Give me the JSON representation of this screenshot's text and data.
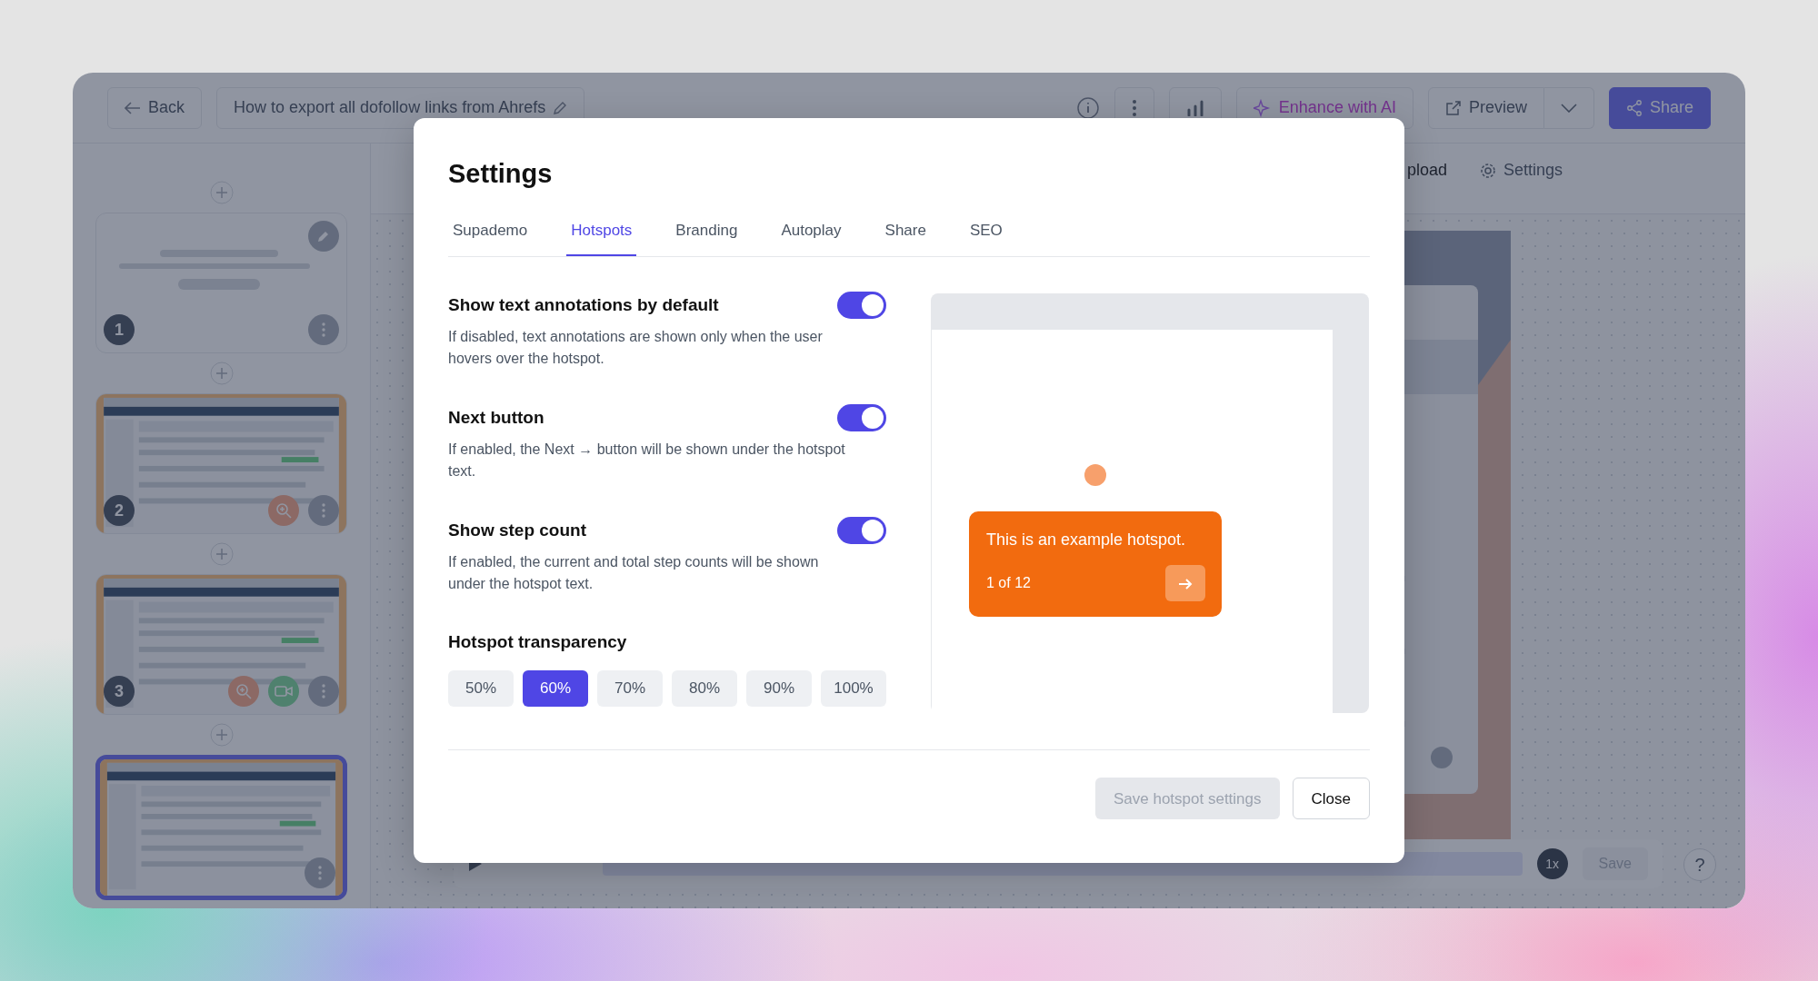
{
  "topbar": {
    "back": "Back",
    "title": "How to export all dofollow links from Ahrefs",
    "enhance": "Enhance with AI",
    "preview": "Preview",
    "share": "Share"
  },
  "toolbar": {
    "items": [
      "pload",
      "Settings"
    ]
  },
  "slides": [
    {
      "kind": "text",
      "number": "1",
      "selected": false
    },
    {
      "kind": "picture",
      "number": "2",
      "zoom": true,
      "selected": false
    },
    {
      "kind": "picture",
      "number": "3",
      "zoom": true,
      "video": true,
      "selected": false
    },
    {
      "kind": "picture",
      "selected": true
    }
  ],
  "player": {
    "speed": "1x",
    "save": "Save"
  },
  "help": "?",
  "modal": {
    "title": "Settings",
    "tabs": [
      {
        "label": "Supademo",
        "selected": false
      },
      {
        "label": "Hotspots",
        "selected": true
      },
      {
        "label": "Branding",
        "selected": false
      },
      {
        "label": "Autoplay",
        "selected": false
      },
      {
        "label": "Share",
        "selected": false
      },
      {
        "label": "SEO",
        "selected": false
      }
    ],
    "options": [
      {
        "title": "Show text annotations by default",
        "description": "If disabled, text annotations are shown only when the user hovers over the hotspot.",
        "on": true
      },
      {
        "title": "Next button",
        "description": "If enabled, the Next → button will be shown under the hotspot text.",
        "on": true
      },
      {
        "title": "Show step count",
        "description": "If enabled, the current and total step counts will be shown under the hotspot text.",
        "on": true
      }
    ],
    "transparency": {
      "label": "Hotspot transparency",
      "options": [
        {
          "label": "50%",
          "selected": false
        },
        {
          "label": "60%",
          "selected": true
        },
        {
          "label": "70%",
          "selected": false
        },
        {
          "label": "80%",
          "selected": false
        },
        {
          "label": "90%",
          "selected": false
        },
        {
          "label": "100%",
          "selected": false
        }
      ]
    },
    "preview": {
      "text": "This is an example hotspot.",
      "step": "1 of 12"
    },
    "save": {
      "label": "Save hotspot settings",
      "disabled": true
    },
    "close": "Close"
  }
}
